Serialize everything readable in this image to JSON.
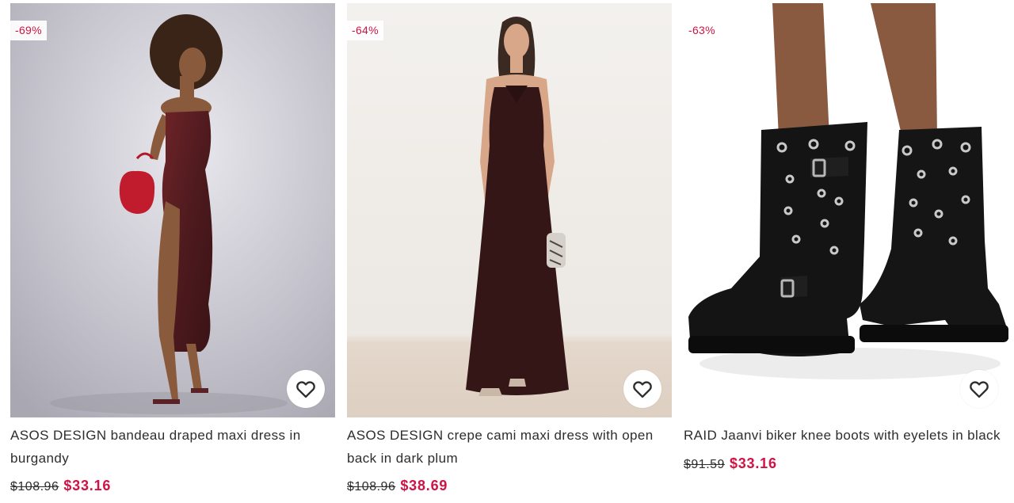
{
  "products": [
    {
      "discount": "-69%",
      "title": "ASOS DESIGN bandeau draped maxi dress in burgandy",
      "was_price": "$108.96",
      "now_price": "$33.16",
      "image_icon": "model-burgundy-dress-photo",
      "wishlist_icon": "heart-icon"
    },
    {
      "discount": "-64%",
      "title": "ASOS DESIGN crepe cami maxi dress with open back in dark plum",
      "was_price": "$108.96",
      "now_price": "$38.69",
      "image_icon": "model-plum-dress-photo",
      "wishlist_icon": "heart-icon"
    },
    {
      "discount": "-63%",
      "title": "RAID Jaanvi biker knee boots with eyelets in black",
      "was_price": "$91.59",
      "now_price": "$33.16",
      "image_icon": "black-biker-boots-photo",
      "wishlist_icon": "heart-icon"
    }
  ],
  "colors": {
    "sale_red": "#d01345",
    "text": "#2d2d2d"
  }
}
